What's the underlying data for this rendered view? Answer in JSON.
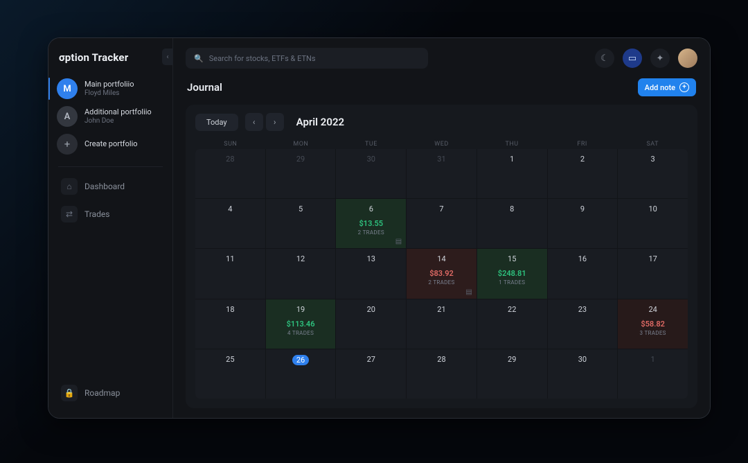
{
  "brand": "σption Tracker",
  "sidebar": {
    "portfolios": [
      {
        "initial": "M",
        "name": "Main portfoliio",
        "owner": "Floyd Miles",
        "active": true
      },
      {
        "initial": "A",
        "name": "Additional portfoliio",
        "owner": "John Doe",
        "active": false
      }
    ],
    "create_label": "Create portfolio",
    "nav": [
      {
        "label": "Dashboard",
        "icon": "home-icon"
      },
      {
        "label": "Trades",
        "icon": "trades-icon"
      }
    ],
    "roadmap_label": "Roadmap"
  },
  "search": {
    "placeholder": "Search for stocks, ETFs & ETNs"
  },
  "page": {
    "title": "Journal",
    "add_note_label": "Add note"
  },
  "calendar": {
    "today_label": "Today",
    "month_label": "April 2022",
    "weekdays": [
      "SUN",
      "MON",
      "TUE",
      "WED",
      "THU",
      "FRI",
      "SAT"
    ],
    "cells": [
      {
        "d": "28",
        "dim": true
      },
      {
        "d": "29",
        "dim": true
      },
      {
        "d": "30",
        "dim": true
      },
      {
        "d": "31",
        "dim": true
      },
      {
        "d": "1"
      },
      {
        "d": "2"
      },
      {
        "d": "3"
      },
      {
        "d": "4"
      },
      {
        "d": "5"
      },
      {
        "d": "6",
        "kind": "green",
        "amt": "$13.55",
        "tc": "2 TRADES",
        "note": true
      },
      {
        "d": "7"
      },
      {
        "d": "8"
      },
      {
        "d": "9"
      },
      {
        "d": "10"
      },
      {
        "d": "11"
      },
      {
        "d": "12"
      },
      {
        "d": "13"
      },
      {
        "d": "14",
        "kind": "red",
        "amt": "$83.92",
        "tc": "2 TRADES",
        "note": true
      },
      {
        "d": "15",
        "kind": "green",
        "amt": "$248.81",
        "tc": "1 TRADES"
      },
      {
        "d": "16"
      },
      {
        "d": "17"
      },
      {
        "d": "18"
      },
      {
        "d": "19",
        "kind": "green",
        "amt": "$113.46",
        "tc": "4 TRADES"
      },
      {
        "d": "20"
      },
      {
        "d": "21"
      },
      {
        "d": "22"
      },
      {
        "d": "23"
      },
      {
        "d": "24",
        "kind": "redlt",
        "amt": "$58.82",
        "tc": "3 TRADES"
      },
      {
        "d": "25"
      },
      {
        "d": "26",
        "today": true
      },
      {
        "d": "27"
      },
      {
        "d": "28"
      },
      {
        "d": "29"
      },
      {
        "d": "30"
      },
      {
        "d": "1",
        "dim": true
      }
    ]
  }
}
